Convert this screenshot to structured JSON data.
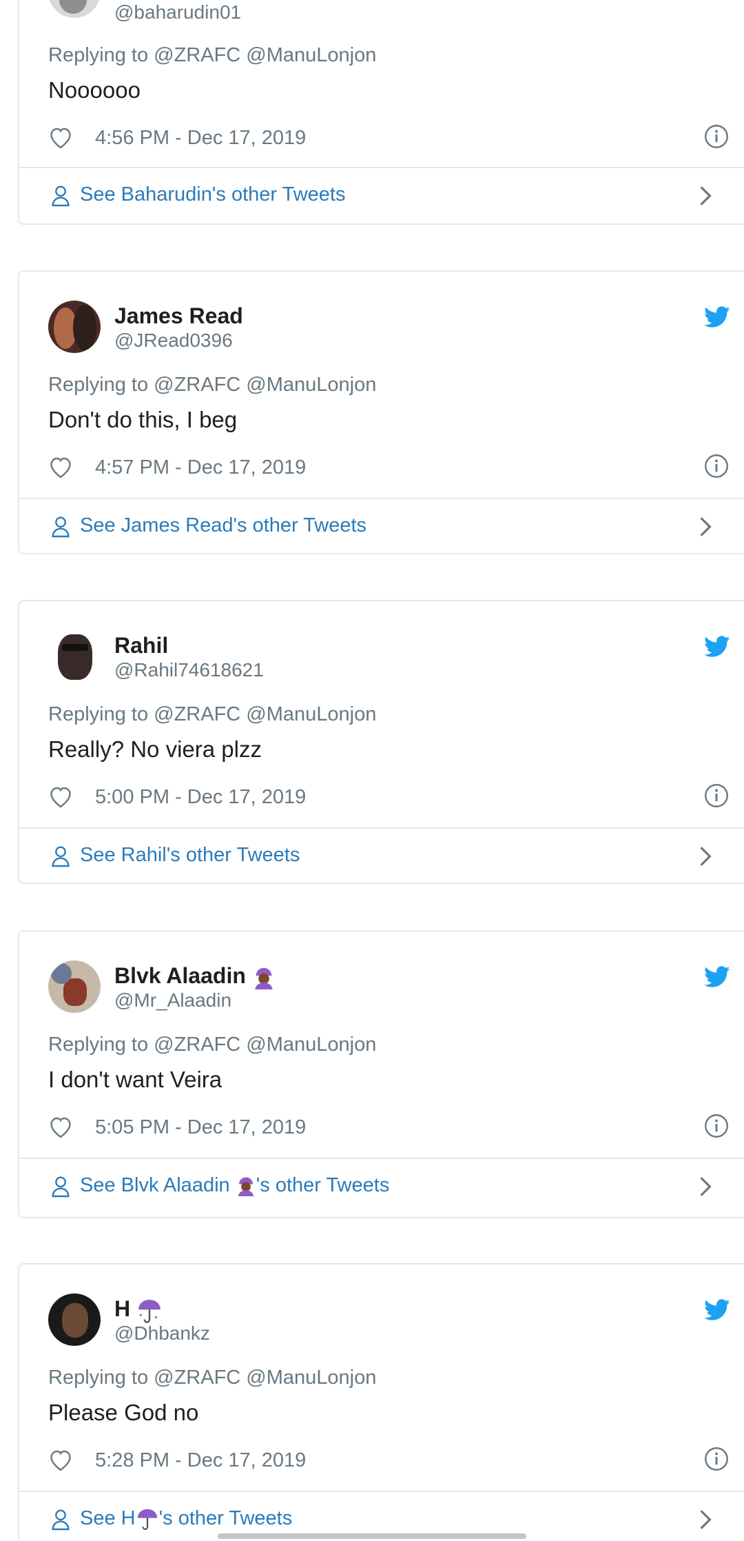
{
  "tweets": [
    {
      "name": "",
      "handle": "@baharudin01",
      "reply_to": "Replying to @ZRAFC @ManuLonjon",
      "text": "Noooooo",
      "time": "4:56 PM - Dec 17, 2019",
      "see_other": "See Baharudin's other Tweets"
    },
    {
      "name": "James Read",
      "handle": "@JRead0396",
      "reply_to": "Replying to @ZRAFC @ManuLonjon",
      "text": "Don't do this, I beg",
      "time": "4:57 PM - Dec 17, 2019",
      "see_other": "See James Read's other Tweets"
    },
    {
      "name": "Rahil",
      "handle": "@Rahil74618621",
      "reply_to": "Replying to @ZRAFC @ManuLonjon",
      "text": "Really? No viera plzz",
      "time": "5:00 PM - Dec 17, 2019",
      "see_other": "See Rahil's other Tweets"
    },
    {
      "name": "Blvk Alaadin",
      "name_emoji": "person-with-turban-emoji",
      "handle": "@Mr_Alaadin",
      "reply_to": "Replying to @ZRAFC @ManuLonjon",
      "text": "I don't want Veira",
      "time": "5:05 PM - Dec 17, 2019",
      "see_other_prefix": "See Blvk Alaadin",
      "see_other_suffix": "'s other Tweets"
    },
    {
      "name": "H",
      "name_emoji": "umbrella-with-rain-emoji",
      "handle": "@Dhbankz",
      "reply_to": "Replying to @ZRAFC @ManuLonjon",
      "text": "Please God no",
      "time": "5:28 PM - Dec 17, 2019",
      "see_other_prefix": "See H",
      "see_other_suffix": "'s other Tweets"
    }
  ],
  "colors": {
    "twitter_blue": "#1da1f2",
    "link_blue": "#2b7bb9",
    "secondary_text": "#697882",
    "border": "#e1e8ed"
  },
  "icons": [
    "heart-icon",
    "info-icon",
    "user-icon",
    "chevron-right-icon",
    "twitter-bird-icon"
  ]
}
